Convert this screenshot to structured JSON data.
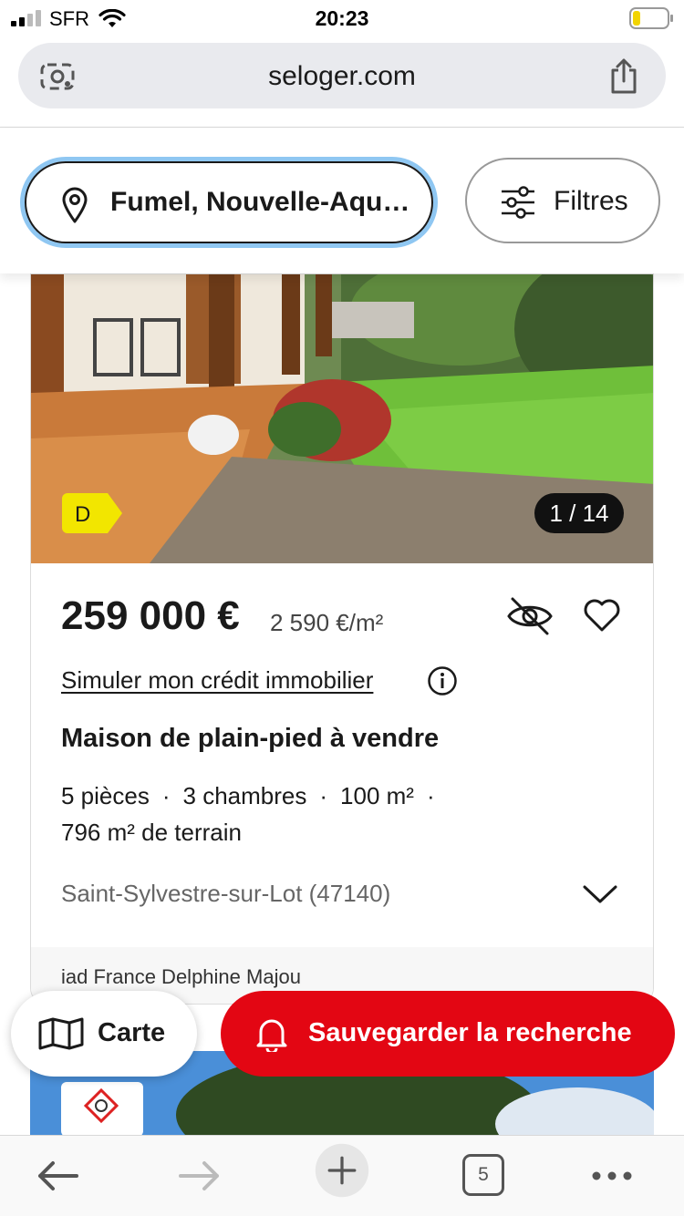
{
  "status_bar": {
    "carrier": "SFR",
    "time": "20:23"
  },
  "browser": {
    "url": "seloger.com",
    "tab_count": "5"
  },
  "search": {
    "location": "Fumel, Nouvelle-Aqu…",
    "filters_label": "Filtres"
  },
  "listing": {
    "energy_class": "D",
    "photo_counter": "1 / 14",
    "price": "259 000 €",
    "price_per_m2": "2 590 €/m²",
    "credit_link": "Simuler mon crédit immobilier",
    "title": "Maison de plain-pied à vendre",
    "features": {
      "rooms": "5 pièces",
      "bedrooms": "3 chambres",
      "area": "100 m²",
      "land": "796 m² de terrain"
    },
    "locality": "Saint-Sylvestre-sur-Lot (47140)",
    "agency": "iad France Delphine Majou"
  },
  "floating_actions": {
    "map_label": "Carte",
    "save_label": "Sauvegarder la recherche"
  },
  "colors": {
    "brand_red": "#e30613",
    "focus_blue": "#8fc7f2",
    "energy_yellow": "#f2e600"
  }
}
